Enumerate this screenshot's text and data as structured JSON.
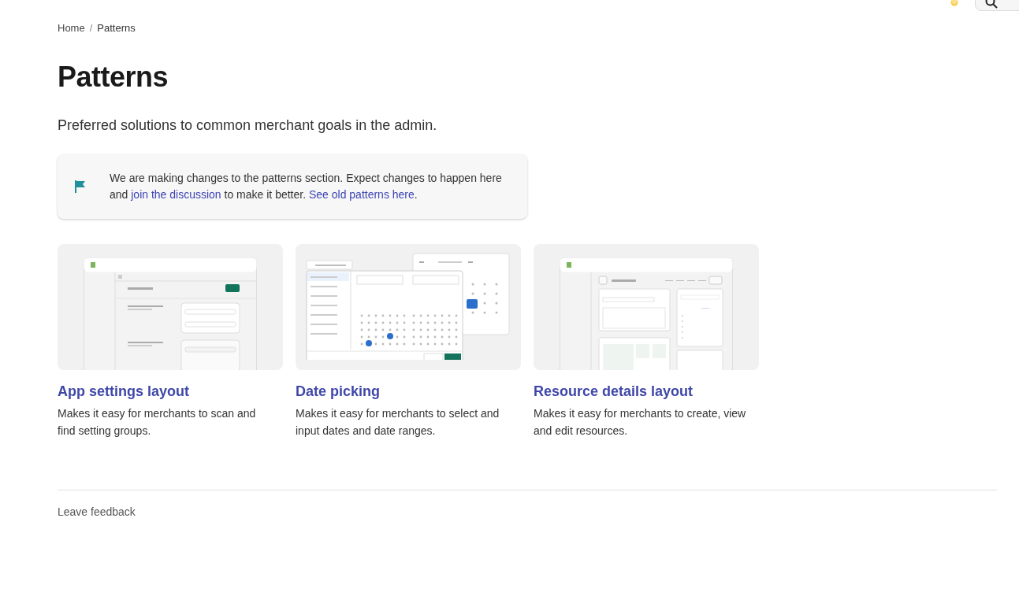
{
  "breadcrumb": [
    {
      "label": "Home",
      "current": false
    },
    {
      "label": "Patterns",
      "current": true
    }
  ],
  "breadcrumb_separator": "/",
  "title": "Patterns",
  "subtitle": "Preferred solutions to common merchant goals in the admin.",
  "notice": {
    "parts": [
      {
        "kind": "text",
        "text": "We are making changes to the patterns section. Expect changes to happen here and "
      },
      {
        "kind": "link",
        "text": "join the discussion"
      },
      {
        "kind": "text",
        "text": " to make it better. "
      },
      {
        "kind": "link",
        "text": "See old patterns here"
      },
      {
        "kind": "text",
        "text": "."
      }
    ]
  },
  "patterns": [
    {
      "kind": "app-settings",
      "title": "App settings layout",
      "description": "Makes it easy for merchants to scan and find setting groups."
    },
    {
      "kind": "date-picking",
      "title": "Date picking",
      "description": "Makes it easy for merchants to select and input dates and date ranges."
    },
    {
      "kind": "resource-details",
      "title": "Resource details layout",
      "description": "Makes it easy for merchants to create, view and edit resources."
    }
  ],
  "footer": {
    "feedback": "Leave feedback"
  }
}
